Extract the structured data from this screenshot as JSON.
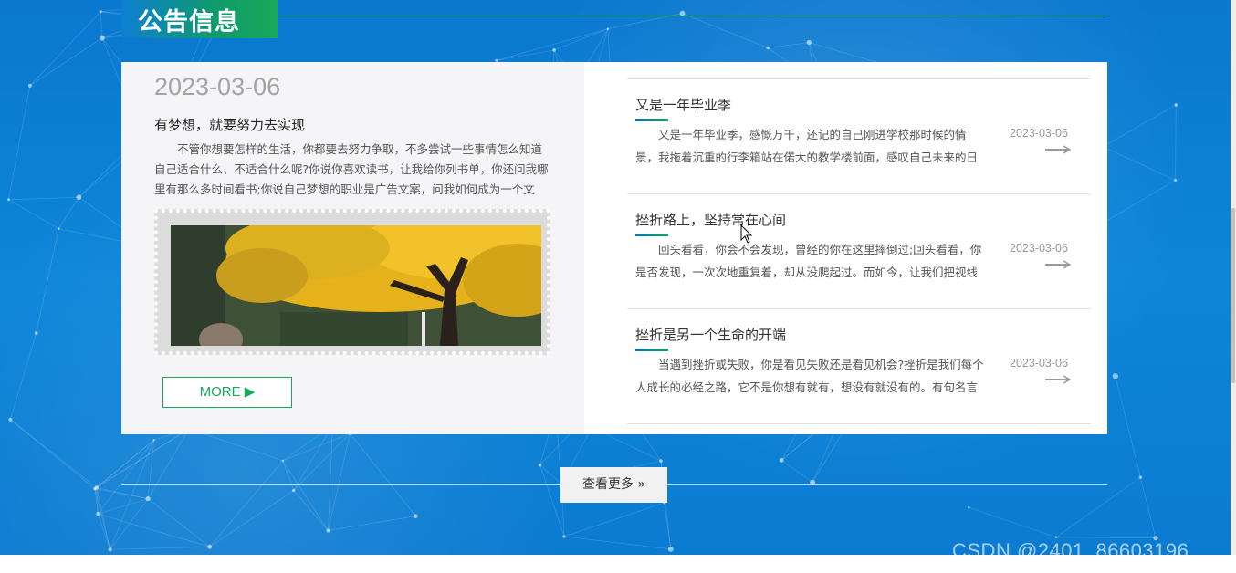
{
  "section": {
    "title": "公告信息"
  },
  "featured": {
    "date": "2023-03-06",
    "title": "有梦想，就要努力去实现",
    "text": "不管你想要怎样的生活，你都要去努力争取，不多尝试一些事情怎么知道自己适合什么、不适合什么呢?你说你喜欢读书，让我给你列书单，你还问我哪里有那么多时间看书;你说自己梦想的职业是广告文案，问我如何成为一个文",
    "more_label": "MORE ▶"
  },
  "news_list": [
    {
      "title": "又是一年毕业季",
      "text": "又是一年毕业季，感慨万千，还记的自己刚进学校那时候的情景，我拖着沉重的行李箱站在偌大的教学楼前面，感叹自己未来的日子即将",
      "date": "2023-03-06"
    },
    {
      "title": "挫折路上，坚持常在心间",
      "text": "回头看看，你会不会发现，曾经的你在这里摔倒过;回头看看，你是否发现，一次次地重复着，却从没爬起过。而如今，让我们把视线转",
      "date": "2023-03-06"
    },
    {
      "title": "挫折是另一个生命的开端",
      "text": "当遇到挫折或失败，你是看见失败还是看见机会?挫折是我们每个人成长的必经之路，它不是你想有就有，想没有就没有的。有句名言说",
      "date": "2023-03-06"
    }
  ],
  "see_more": {
    "label": "查看更多 »"
  },
  "watermark": "CSDN @2401_86603196",
  "colors": {
    "accent_green": "#19a85a",
    "background_blue": "#0b7fd3"
  }
}
